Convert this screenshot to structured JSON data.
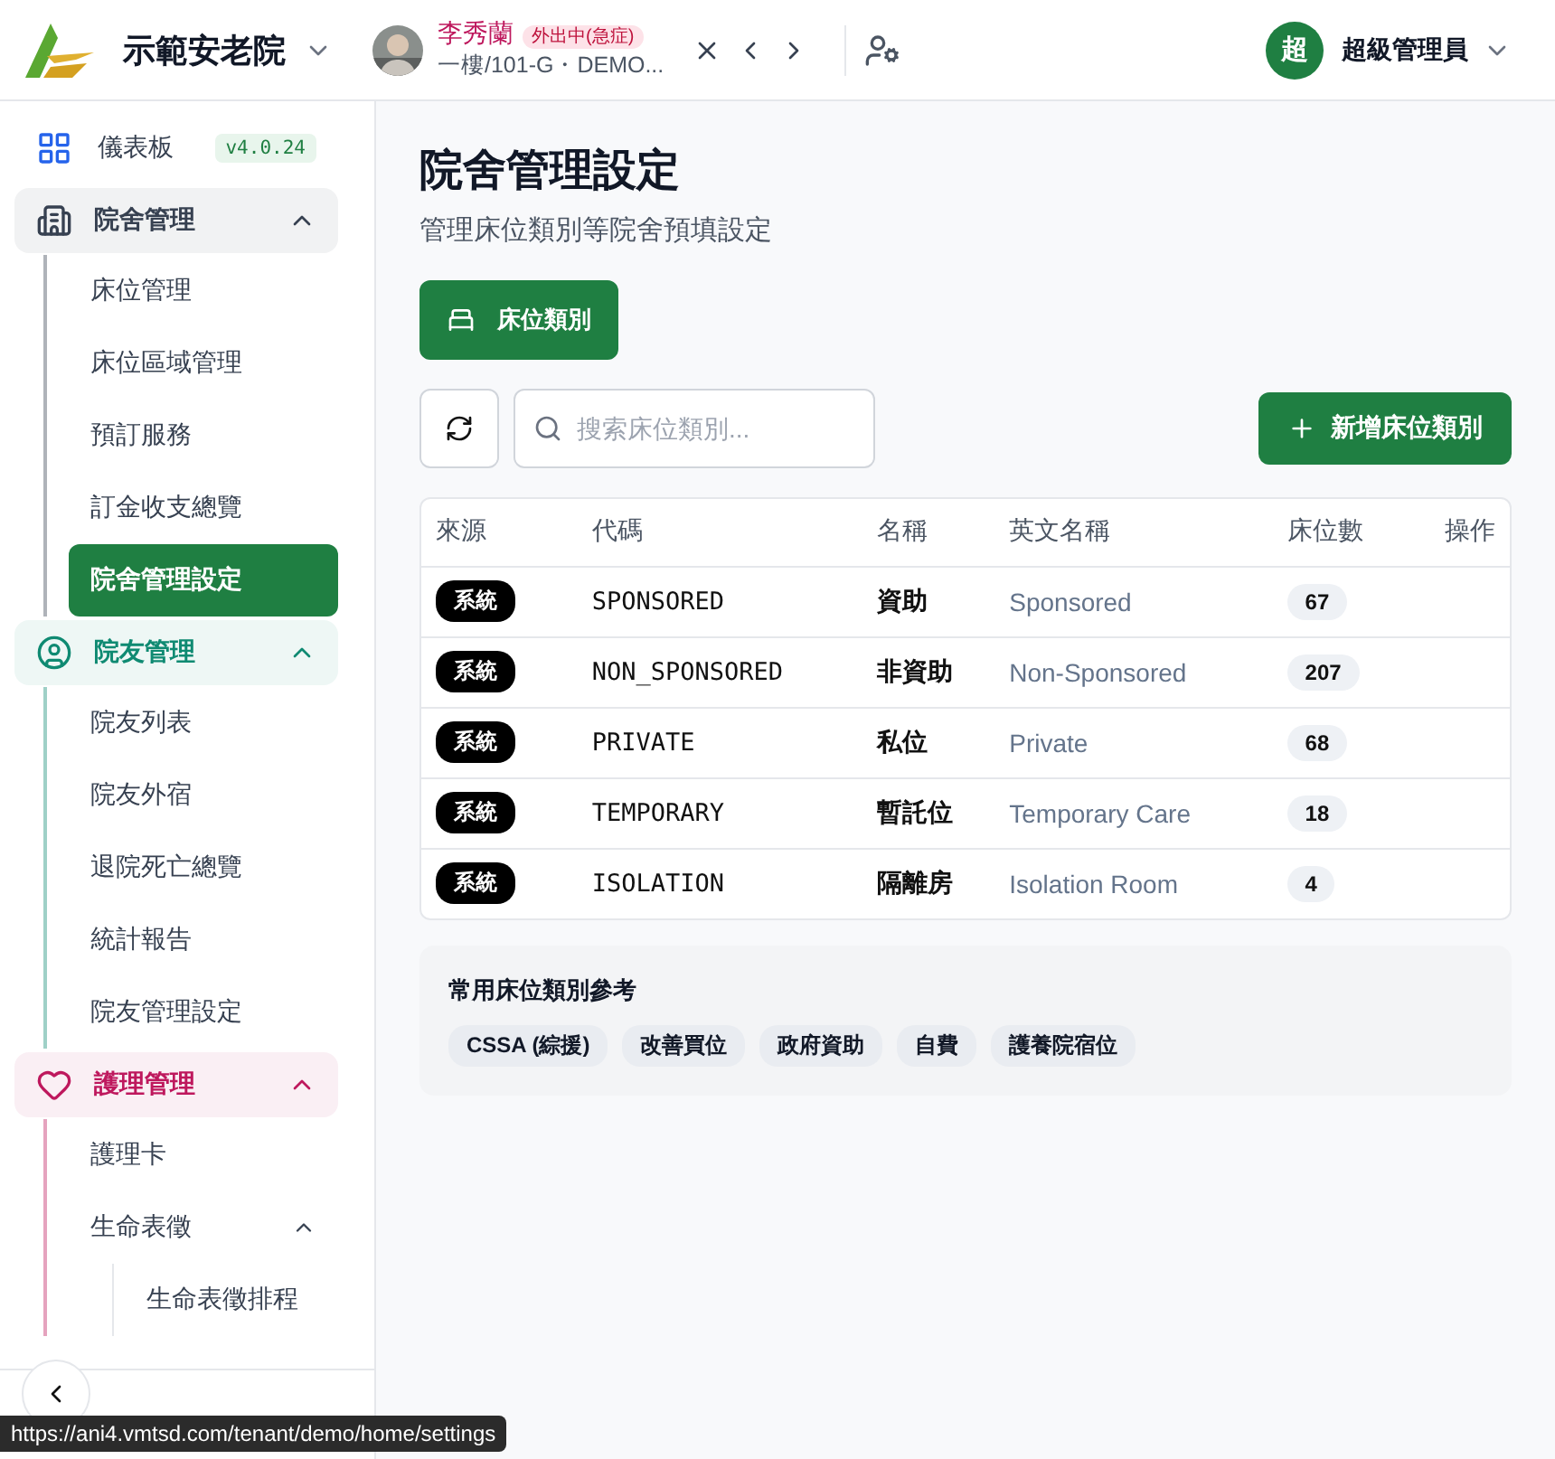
{
  "header": {
    "org_name": "示範安老院",
    "resident": {
      "name": "李秀蘭",
      "status": "外出中(急症)",
      "location": "一樓/101-G・DEMO..."
    },
    "user": {
      "avatar_letter": "超",
      "name": "超級管理員"
    }
  },
  "sidebar": {
    "items": [
      {
        "kind": "link",
        "label": "儀表板",
        "badge": "v4.0.24",
        "selected": false
      },
      {
        "kind": "group",
        "label": "院舍管理",
        "expanded": true,
        "color": "#374151",
        "children": [
          {
            "kind": "link",
            "label": "床位管理",
            "selected": false
          },
          {
            "kind": "link",
            "label": "床位區域管理",
            "selected": false
          },
          {
            "kind": "link",
            "label": "預訂服務",
            "selected": false
          },
          {
            "kind": "link",
            "label": "訂金收支總覽",
            "selected": false
          },
          {
            "kind": "link",
            "label": "院舍管理設定",
            "selected": true
          }
        ]
      },
      {
        "kind": "group",
        "label": "院友管理",
        "expanded": true,
        "color": "#0f8a72",
        "children": [
          {
            "kind": "link",
            "label": "院友列表",
            "selected": false
          },
          {
            "kind": "link",
            "label": "院友外宿",
            "selected": false
          },
          {
            "kind": "link",
            "label": "退院死亡總覽",
            "selected": false
          },
          {
            "kind": "link",
            "label": "統計報告",
            "selected": false
          },
          {
            "kind": "link",
            "label": "院友管理設定",
            "selected": false
          }
        ]
      },
      {
        "kind": "group",
        "label": "護理管理",
        "expanded": true,
        "color": "#be185d",
        "children": [
          {
            "kind": "link",
            "label": "護理卡",
            "selected": false
          },
          {
            "kind": "group",
            "label": "生命表徵",
            "expanded": true,
            "children": [
              {
                "kind": "link",
                "label": "生命表徵排程",
                "selected": false
              }
            ]
          }
        ]
      }
    ]
  },
  "page": {
    "title": "院舍管理設定",
    "subtitle": "管理床位類別等院舍預填設定",
    "tabs": [
      {
        "label": "床位類別",
        "selected": true
      }
    ],
    "search": {
      "placeholder": "搜索床位類別..."
    },
    "add_button": "新增床位類別",
    "table": {
      "columns": [
        "來源",
        "代碼",
        "名稱",
        "英文名稱",
        "床位數",
        "操作"
      ],
      "rows": [
        {
          "source": "系統",
          "code": "SPONSORED",
          "name": "資助",
          "english_name": "Sponsored",
          "beds": "67"
        },
        {
          "source": "系統",
          "code": "NON_SPONSORED",
          "name": "非資助",
          "english_name": "Non-Sponsored",
          "beds": "207"
        },
        {
          "source": "系統",
          "code": "PRIVATE",
          "name": "私位",
          "english_name": "Private",
          "beds": "68"
        },
        {
          "source": "系統",
          "code": "TEMPORARY",
          "name": "暫託位",
          "english_name": "Temporary Care",
          "beds": "18"
        },
        {
          "source": "系統",
          "code": "ISOLATION",
          "name": "隔離房",
          "english_name": "Isolation Room",
          "beds": "4"
        }
      ]
    },
    "reference": {
      "title": "常用床位類別參考",
      "tags": [
        "CSSA (綜援)",
        "改善買位",
        "政府資助",
        "自費",
        "護養院宿位"
      ]
    }
  },
  "status_url": "https://ani4.vmtsd.com/tenant/demo/home/settings"
}
